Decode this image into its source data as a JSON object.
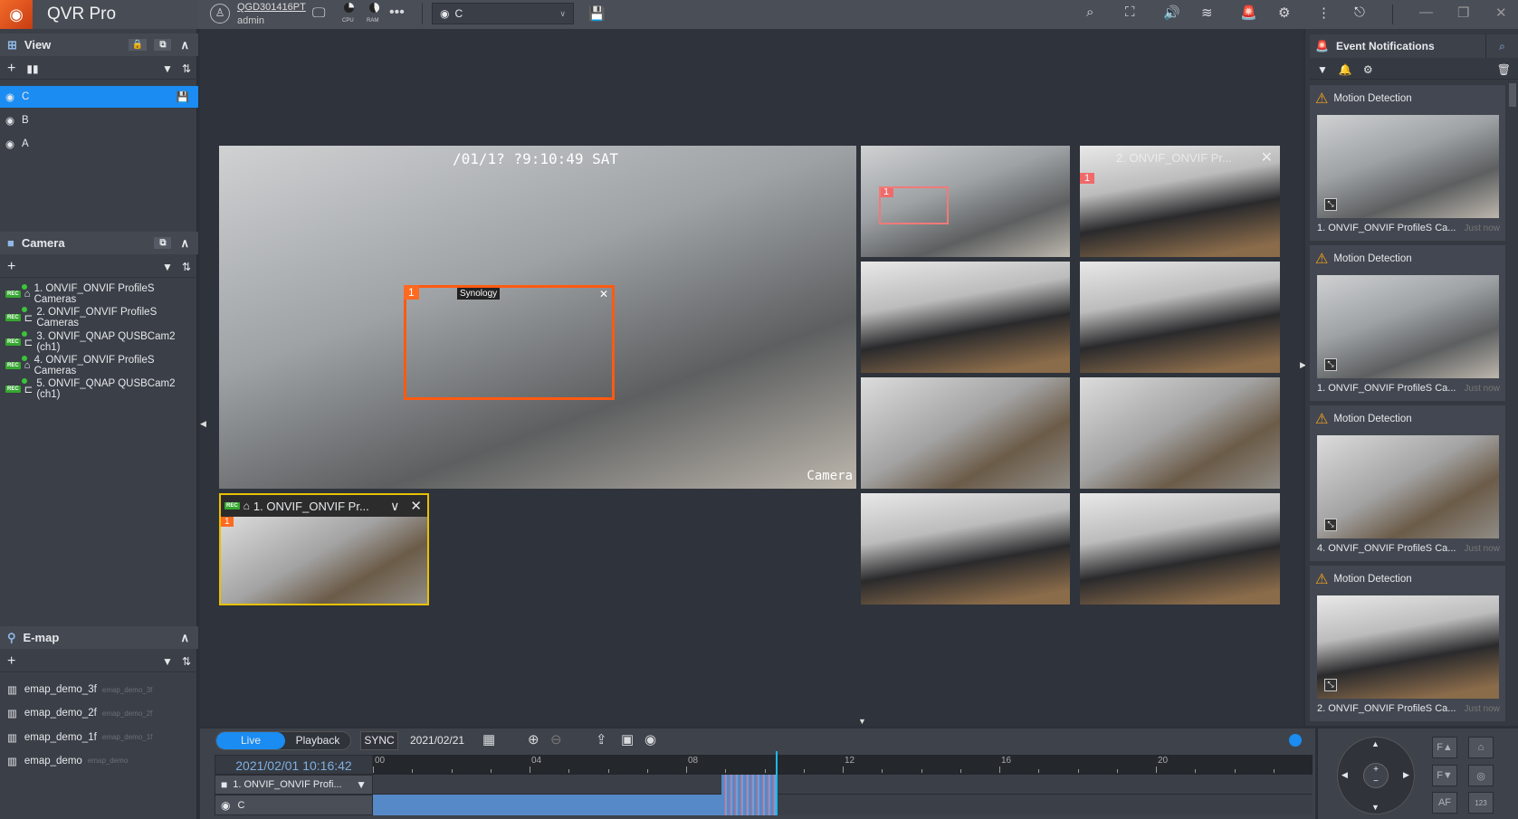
{
  "app": {
    "title": "QVR Pro",
    "server": "QGD301416PT",
    "user": "admin",
    "cpu_label": "CPU",
    "ram_label": "RAM",
    "view_select": "C"
  },
  "view_panel": {
    "title": "View",
    "items": [
      {
        "label": "C",
        "selected": true
      },
      {
        "label": "B"
      },
      {
        "label": "A"
      }
    ]
  },
  "camera_panel": {
    "title": "Camera",
    "items": [
      {
        "label": "1. ONVIF_ONVIF ProfileS Cameras",
        "type": "ptz",
        "rec": "REC"
      },
      {
        "label": "2. ONVIF_ONVIF ProfileS Cameras",
        "type": "bullet",
        "rec": "REC"
      },
      {
        "label": "3. ONVIF_QNAP QUSBCam2 (ch1)",
        "type": "bullet",
        "rec": "REC"
      },
      {
        "label": "4. ONVIF_ONVIF ProfileS Cameras",
        "type": "ptz",
        "rec": "REC"
      },
      {
        "label": "5. ONVIF_QNAP QUSBCam2 (ch1)",
        "type": "bullet",
        "rec": "REC"
      }
    ]
  },
  "emap_panel": {
    "title": "E-map",
    "items": [
      {
        "label": "emap_demo_3f",
        "sub": "emap_demo_3f"
      },
      {
        "label": "emap_demo_2f",
        "sub": "emap_demo_2f"
      },
      {
        "label": "emap_demo_1f",
        "sub": "emap_demo_1f"
      },
      {
        "label": "emap_demo",
        "sub": "emap_demo"
      }
    ]
  },
  "main_video": {
    "osd_time": "/01/1? ?9:10:49 SAT",
    "osd_name": "Camera",
    "zone_label": "1",
    "brand": "Synology"
  },
  "pip_tile": {
    "title": "1. ONVIF_ONVIF Pr...",
    "zone_label": "1"
  },
  "grid_tiles": [
    {
      "zone": "1"
    },
    {
      "zone": "1",
      "title": "2. ONVIF_ONVIF Pr..."
    },
    {},
    {},
    {},
    {},
    {},
    {}
  ],
  "events": {
    "title": "Event Notifications",
    "items": [
      {
        "type": "Motion Detection",
        "camera": "1. ONVIF_ONVIF ProfileS Ca...",
        "time": "Just now"
      },
      {
        "type": "Motion Detection",
        "camera": "1. ONVIF_ONVIF ProfileS Ca...",
        "time": "Just now"
      },
      {
        "type": "Motion Detection",
        "camera": "4. ONVIF_ONVIF ProfileS Ca...",
        "time": "Just now"
      },
      {
        "type": "Motion Detection",
        "camera": "2. ONVIF_ONVIF ProfileS Ca...",
        "time": "Just now"
      }
    ]
  },
  "timeline": {
    "mode_live": "Live",
    "mode_playback": "Playback",
    "active_mode": "Live",
    "sync": "SYNC",
    "date": "2021/02/21",
    "current_time": "2021/02/01 10:16:42",
    "ticks": [
      "00",
      "04",
      "08",
      "12",
      "16",
      "20"
    ],
    "rows": [
      {
        "label": "1. ONVIF_ONVIF Profi..."
      },
      {
        "label": "C"
      }
    ],
    "playhead_hour": 10.28,
    "recorded_until_hour": 8.9,
    "accent": "#1a8cf2"
  },
  "ptz": {
    "focus_far": "F▲",
    "focus_near": "F▼",
    "autofocus": "AF",
    "preset": "123"
  }
}
